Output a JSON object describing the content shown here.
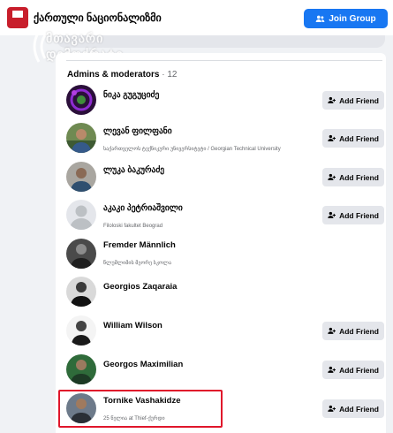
{
  "header": {
    "group_name": "ქართული ნაციონალიზმი",
    "join_label": "Join Group",
    "colors": {
      "accent": "#1877f2",
      "highlight": "#e0162b"
    }
  },
  "watermark": {
    "line1": "მთავარი",
    "line2": "დემოქრატი"
  },
  "search": {
    "placeholder": "ᲛᲗᲐᲕᲐᲠᲘ"
  },
  "admins": {
    "title": "Admins & moderators",
    "separator": " · ",
    "count": "12",
    "members": [
      {
        "name": "ნიკა გუგუციძე",
        "subtitle": "",
        "action": "Add Friend",
        "icon": "add-friend-icon"
      },
      {
        "name": "ლევან ფილფანი",
        "subtitle": "საქართველოს ტექნიკური უნივერსიტეტი / Georgian Technical University",
        "action": "Add Friend",
        "icon": "add-friend-icon"
      },
      {
        "name": "ლუკა ბაკურაძე",
        "subtitle": "",
        "action": "Add Friend",
        "icon": "add-friend-icon"
      },
      {
        "name": "აკაკი პეტრიაშვილი",
        "subtitle": "Filoloski fakultet Beograd",
        "action": "Add Friend",
        "icon": "add-friend-icon"
      },
      {
        "name": "Fremder Männlich",
        "subtitle": "წლუმლიმის მეორე სკოლა",
        "action": "",
        "icon": ""
      },
      {
        "name": "Georgios Zaqaraia",
        "subtitle": "",
        "action": "",
        "icon": ""
      },
      {
        "name": "William Wilson",
        "subtitle": "",
        "action": "Add Friend",
        "icon": "add-friend-icon"
      },
      {
        "name": "Georgos Maximilian",
        "subtitle": "",
        "action": "Add Friend",
        "icon": "add-friend-icon"
      },
      {
        "name": "Tornike Vashakidze",
        "subtitle": "25 წელია at Thief-ქურდი",
        "action": "Add Friend",
        "icon": "add-friend-icon"
      }
    ]
  }
}
